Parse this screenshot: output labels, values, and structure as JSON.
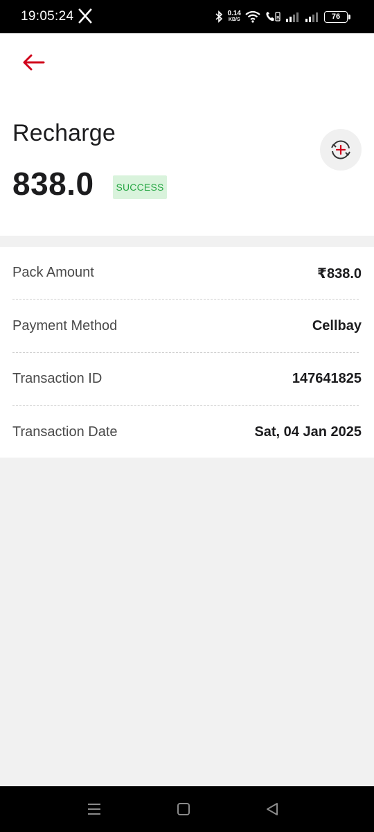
{
  "status_bar": {
    "time": "19:05:24",
    "net_speed_value": "0.14",
    "net_speed_unit": "KB/S",
    "battery_level": "76",
    "icons": [
      "x-icon",
      "bluetooth-icon",
      "wifi-icon",
      "volte-call-icon",
      "signal-icon",
      "signal-icon",
      "battery-icon"
    ]
  },
  "header": {
    "title": "Recharge",
    "amount": "838.0",
    "status": "SUCCESS",
    "colors": {
      "back_arrow": "#d0021b",
      "status_bg": "#d9f3dc",
      "status_text": "#28a745"
    }
  },
  "details": {
    "rows": [
      {
        "label": "Pack Amount",
        "value": "₹838.0"
      },
      {
        "label": "Payment Method",
        "value": "Cellbay"
      },
      {
        "label": "Transaction ID",
        "value": "147641825"
      },
      {
        "label": "Transaction Date",
        "value": "Sat, 04 Jan 2025"
      }
    ]
  },
  "nav_bar": {
    "icons": [
      "menu-icon",
      "home-icon",
      "back-icon"
    ]
  }
}
